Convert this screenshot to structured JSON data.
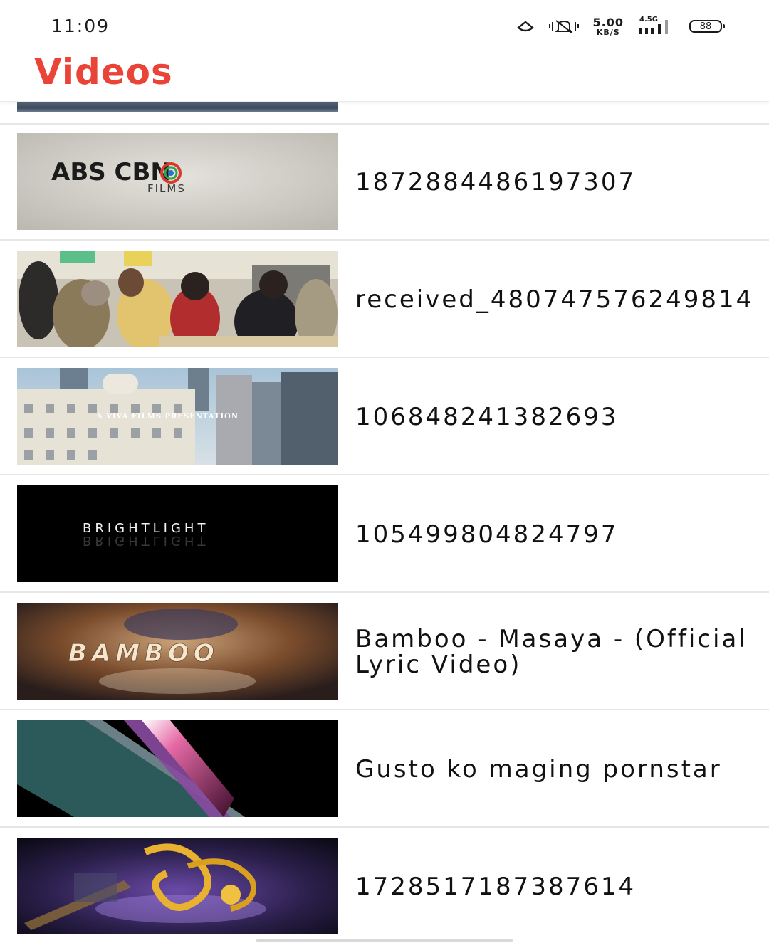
{
  "status_bar": {
    "time": "11:09",
    "net_speed_value": "5.00",
    "net_speed_unit": "KB/S",
    "network_type": "4.5G",
    "battery": "88"
  },
  "header": {
    "title": "Videos",
    "title_color": "#ea4338"
  },
  "videos": [
    {
      "title": "1872884486197307",
      "thumbnail_icon": "abs-cbn-films-logo",
      "thumbnail_text": "ABS CBN",
      "thumbnail_subtext": "FILMS"
    },
    {
      "title": "received_480747576249814",
      "thumbnail_icon": "group-of-people-photo"
    },
    {
      "title": "106848241382693",
      "thumbnail_icon": "city-buildings-photo",
      "thumbnail_text": "A VIVA FILMS PRESENTATION"
    },
    {
      "title": "105499804824797",
      "thumbnail_icon": "brightlight-logo",
      "thumbnail_text": "BRIGHTLIGHT"
    },
    {
      "title": "Bamboo - Masaya - (Official Lyric Video)",
      "thumbnail_icon": "bamboo-logo",
      "thumbnail_text": "BAMBOO"
    },
    {
      "title": "Gusto ko maging pornstar",
      "thumbnail_icon": "abstract-stripes"
    },
    {
      "title": "1728517187387614",
      "thumbnail_icon": "golden-trophy-logo"
    }
  ]
}
